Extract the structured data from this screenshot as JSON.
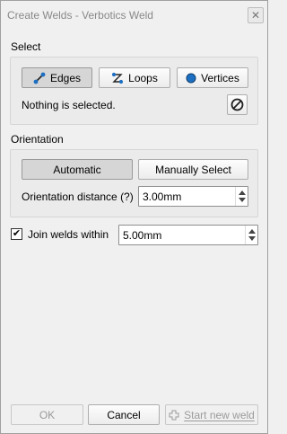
{
  "window": {
    "title": "Create Welds - Verbotics Weld"
  },
  "select": {
    "heading": "Select",
    "edges_label": "Edges",
    "loops_label": "Loops",
    "vertices_label": "Vertices",
    "status": "Nothing is selected."
  },
  "orientation": {
    "heading": "Orientation",
    "automatic_label": "Automatic",
    "manual_label": "Manually Select",
    "distance_label": "Orientation distance (?)",
    "distance_value": "3.00mm"
  },
  "join": {
    "label": "Join welds within",
    "checked": true,
    "value": "5.00mm"
  },
  "footer": {
    "ok_label": "OK",
    "cancel_label": "Cancel",
    "start_label": "Start new weld"
  },
  "colors": {
    "accent": "#1d6fc2",
    "disabled_text": "#9a9a9a"
  }
}
